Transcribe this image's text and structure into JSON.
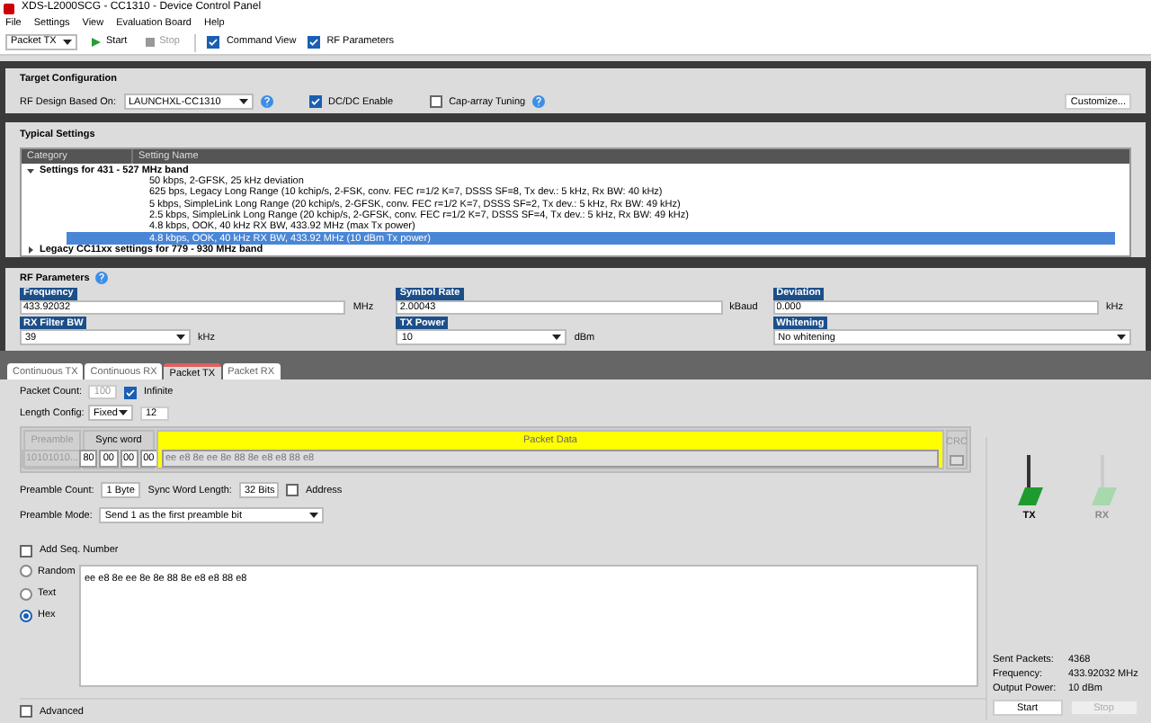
{
  "window": {
    "title": "XDS-L2000SCG - CC1310 - Device Control Panel"
  },
  "menu": [
    "File",
    "Settings",
    "View",
    "Evaluation Board",
    "Help"
  ],
  "toolbar": {
    "mode": "Packet TX",
    "start": "Start",
    "stop": "Stop",
    "stop_disabled": true,
    "toggles": [
      {
        "label": "Command View",
        "checked": true
      },
      {
        "label": "RF Parameters",
        "checked": true
      }
    ]
  },
  "target": {
    "title": "Target Configuration",
    "design_label": "RF Design Based On:",
    "design": "LAUNCHXL-CC1310",
    "dcdc": {
      "label": "DC/DC Enable",
      "checked": true
    },
    "cap": {
      "label": "Cap-array Tuning",
      "checked": false
    },
    "customize": "Customize..."
  },
  "typical": {
    "title": "Typical Settings",
    "columns": [
      "Category",
      "Setting Name"
    ],
    "groups": [
      {
        "label": "Settings for 431 - 527 MHz band",
        "expanded": true,
        "children": [
          {
            "label": "50 kbps, 2-GFSK, 25 kHz deviation",
            "selected": false
          },
          {
            "label": "625 bps, Legacy Long Range (10 kchip/s, 2-FSK, conv. FEC r=1/2 K=7, DSSS SF=8, Tx dev.: 5 kHz, Rx BW: 40 kHz)",
            "selected": false
          },
          {
            "label": "5 kbps, SimpleLink Long Range (20 kchip/s, 2-GFSK, conv. FEC r=1/2 K=7, DSSS SF=2, Tx dev.: 5 kHz, Rx BW: 49 kHz)",
            "selected": false
          },
          {
            "label": "2.5 kbps, SimpleLink Long Range (20 kchip/s, 2-GFSK, conv. FEC r=1/2 K=7, DSSS SF=4, Tx dev.: 5 kHz, Rx BW: 49 kHz)",
            "selected": false
          },
          {
            "label": "4.8 kbps, OOK, 40 kHz RX BW, 433.92 MHz (max Tx power)",
            "selected": false
          },
          {
            "label": "4.8 kbps, OOK, 40 kHz RX BW, 433.92 MHz (10 dBm Tx power)",
            "selected": true
          }
        ]
      },
      {
        "label": "Legacy CC11xx settings for 779 - 930 MHz band",
        "expanded": false
      }
    ]
  },
  "rf": {
    "title": "RF Parameters",
    "fields": [
      {
        "label": "Frequency",
        "kind": "input",
        "value": "433.92032",
        "unit": "MHz"
      },
      {
        "label": "Symbol Rate",
        "kind": "input",
        "value": "2.00043",
        "unit": "kBaud"
      },
      {
        "label": "Deviation",
        "kind": "input",
        "value": "0.000",
        "unit": "kHz"
      },
      {
        "label": "RX Filter BW",
        "kind": "select",
        "value": "39",
        "unit": "kHz"
      },
      {
        "label": "TX Power",
        "kind": "select",
        "value": "10",
        "unit": "dBm"
      },
      {
        "label": "Whitening",
        "kind": "select",
        "value": "No whitening"
      }
    ]
  },
  "tabs": [
    {
      "label": "Continuous TX",
      "selected": false
    },
    {
      "label": "Continuous RX",
      "selected": false
    },
    {
      "label": "Packet TX",
      "selected": true
    },
    {
      "label": "Packet RX",
      "selected": false
    }
  ],
  "packet": {
    "count_label": "Packet Count:",
    "count": "100",
    "infinite": {
      "label": "Infinite",
      "checked": true
    },
    "length_label": "Length Config:",
    "length_mode": "Fixed",
    "length": "12",
    "preamble": {
      "title": "Preamble",
      "value": "10101010..."
    },
    "sync": {
      "title": "Sync word",
      "bytes": [
        "80",
        "00",
        "00",
        "00"
      ]
    },
    "data": {
      "title": "Packet Data",
      "value": "ee e8 8e ee 8e 88 8e e8 e8 88 e8"
    },
    "crc": {
      "title": "CRC"
    },
    "preamble_count_label": "Preamble Count:",
    "preamble_count": "1 Byte",
    "sync_len_label": "Sync Word Length:",
    "sync_len": "32 Bits",
    "address": {
      "label": "Address",
      "checked": false
    },
    "preamble_mode_label": "Preamble Mode:",
    "preamble_mode": "Send 1 as the first preamble bit",
    "seq": {
      "label": "Add Seq. Number",
      "checked": false
    },
    "radios": [
      {
        "label": "Random",
        "selected": false
      },
      {
        "label": "Text",
        "selected": false
      },
      {
        "label": "Hex",
        "selected": true
      }
    ],
    "payload": "ee e8 8e ee 8e 8e 88 8e e8 e8 88 e8",
    "advanced": {
      "label": "Advanced",
      "checked": false
    }
  },
  "status": {
    "antennas": [
      {
        "label": "TX",
        "active": true
      },
      {
        "label": "RX",
        "active": false
      }
    ],
    "stats": [
      {
        "label": "Sent Packets:",
        "value": "4368"
      },
      {
        "label": "Frequency:",
        "value": "433.92032 MHz"
      },
      {
        "label": "Output Power:",
        "value": "10 dBm"
      }
    ],
    "start": "Start",
    "stop": "Stop",
    "stop_disabled": true
  }
}
